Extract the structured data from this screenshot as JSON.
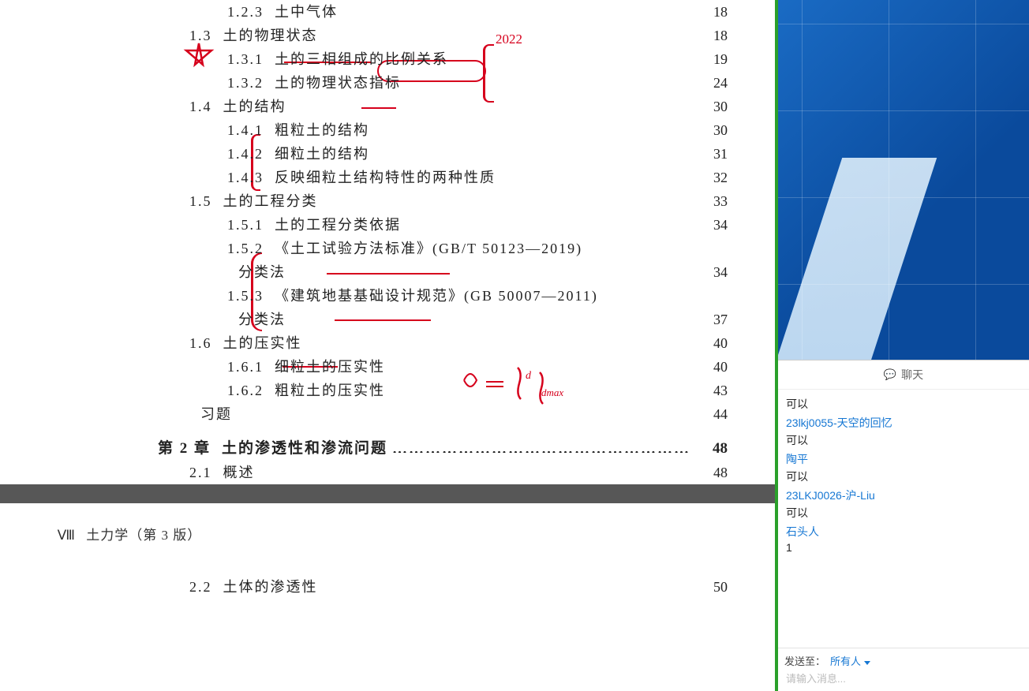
{
  "toc": [
    {
      "level": 2,
      "num": "1.2.3",
      "title": "土中气体",
      "page": "18"
    },
    {
      "level": 1,
      "num": "1.3",
      "title": "土的物理状态",
      "page": "18"
    },
    {
      "level": 2,
      "num": "1.3.1",
      "title": "土的三相组成的比例关系",
      "page": "19"
    },
    {
      "level": 2,
      "num": "1.3.2",
      "title": "土的物理状态指标",
      "page": "24"
    },
    {
      "level": 1,
      "num": "1.4",
      "title": "土的结构",
      "page": "30"
    },
    {
      "level": 2,
      "num": "1.4.1",
      "title": "粗粒土的结构",
      "page": "30"
    },
    {
      "level": 2,
      "num": "1.4.2",
      "title": "细粒土的结构",
      "page": "31"
    },
    {
      "level": 2,
      "num": "1.4.3",
      "title": "反映细粒土结构特性的两种性质",
      "page": "32"
    },
    {
      "level": 1,
      "num": "1.5",
      "title": "土的工程分类",
      "page": "33"
    },
    {
      "level": 2,
      "num": "1.5.1",
      "title": "土的工程分类依据",
      "page": "34"
    },
    {
      "level": 2,
      "num": "1.5.2",
      "title": "《土工试验方法标准》(GB/T 50123—2019)",
      "page": "",
      "noDots": true
    },
    {
      "level": 2,
      "num": "",
      "title": "分类法",
      "page": "34",
      "cont": true
    },
    {
      "level": 2,
      "num": "1.5.3",
      "title": "《建筑地基基础设计规范》(GB 50007—2011)",
      "page": "",
      "noDots": true
    },
    {
      "level": 2,
      "num": "",
      "title": "分类法",
      "page": "37",
      "cont": true
    },
    {
      "level": 1,
      "num": "1.6",
      "title": "土的压实性",
      "page": "40"
    },
    {
      "level": 2,
      "num": "1.6.1",
      "title": "细粒土的压实性",
      "page": "40"
    },
    {
      "level": 2,
      "num": "1.6.2",
      "title": "粗粒土的压实性",
      "page": "43"
    },
    {
      "level": 0,
      "num": "",
      "title": "习题",
      "page": "44",
      "xiti": true
    },
    {
      "level": -1,
      "num": "第 2 章",
      "title": "土的渗透性和渗流问题",
      "page": "48",
      "chapter": true
    },
    {
      "level": 1,
      "num": "2.1",
      "title": "概述",
      "page": "48"
    }
  ],
  "footer": {
    "roman": "Ⅷ",
    "text": "土力学（第 3 版）"
  },
  "next_toc": {
    "level": 1,
    "num": "2.2",
    "title": "土体的渗透性",
    "page": "50"
  },
  "annotations": {
    "note_2022": "2022",
    "formula": "λ = ρd/ρdmax"
  },
  "chat": {
    "header": "聊天",
    "messages": [
      {
        "name": "",
        "text": "可以"
      },
      {
        "name": "23lkj0055-天空的回忆",
        "text": ""
      },
      {
        "name": "",
        "text": "可以"
      },
      {
        "name": "陶平",
        "text": ""
      },
      {
        "name": "",
        "text": "可以"
      },
      {
        "name": "23LKJ0026-沪-Liu",
        "text": ""
      },
      {
        "name": "",
        "text": "可以"
      },
      {
        "name": "石头人",
        "text": ""
      },
      {
        "name": "",
        "text": "1"
      }
    ],
    "send_label": "发送至：",
    "send_target": "所有人",
    "placeholder": "请输入消息..."
  }
}
